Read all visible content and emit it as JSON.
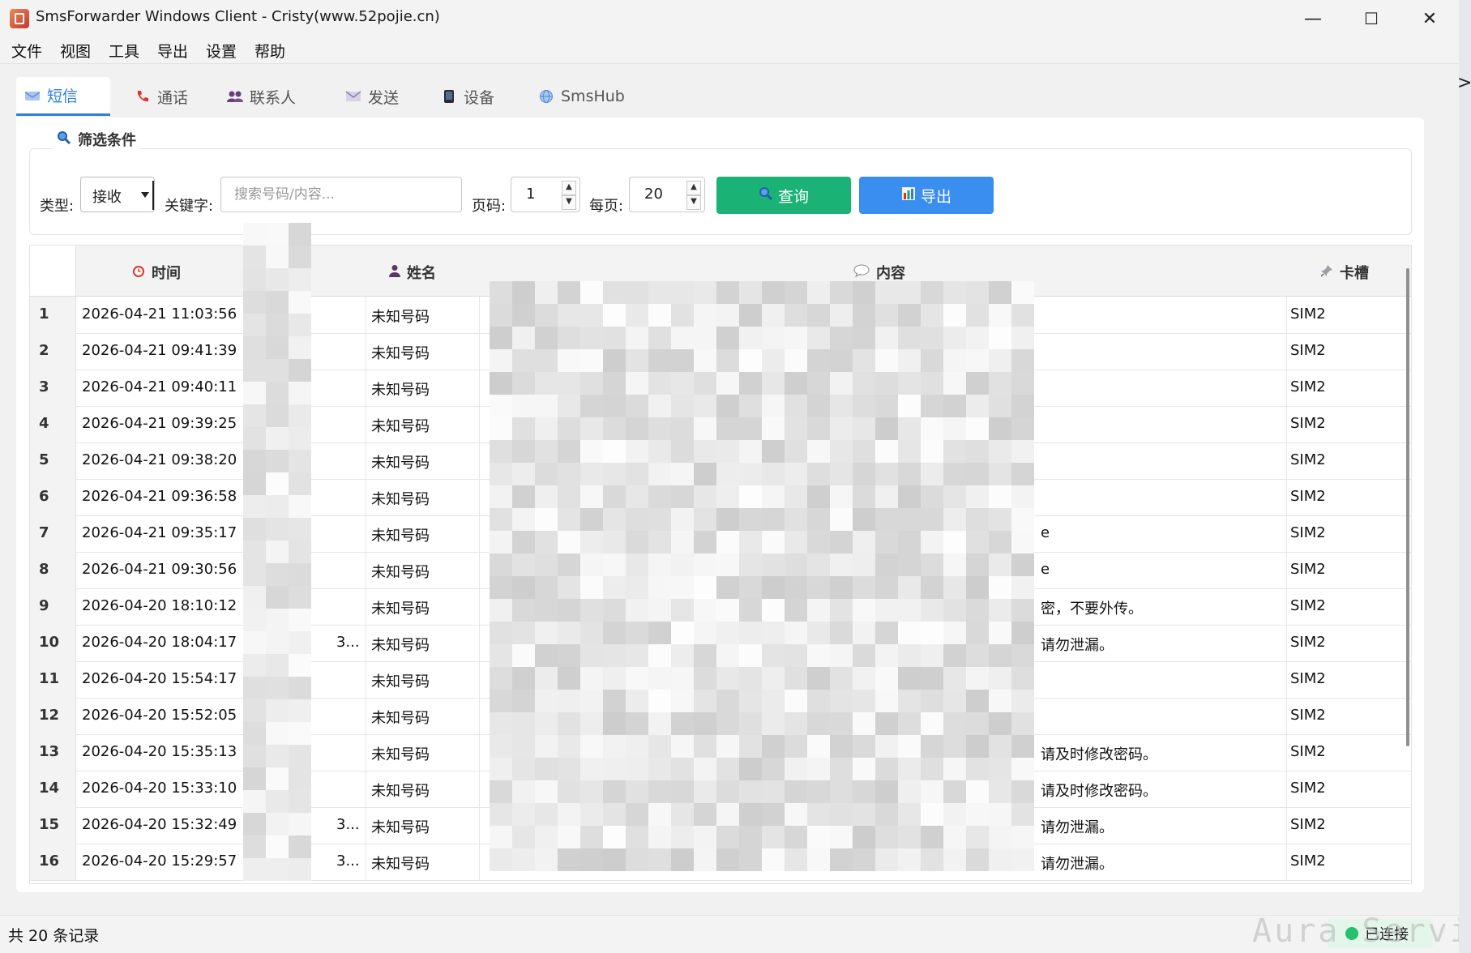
{
  "window": {
    "title": "SmsForwarder Windows Client - Cristy(www.52pojie.cn)",
    "controls": {
      "minimize": "—",
      "maximize": "☐",
      "close": "✕"
    }
  },
  "menu": [
    "文件",
    "视图",
    "工具",
    "导出",
    "设置",
    "帮助"
  ],
  "tabs": [
    {
      "label": "短信",
      "icon": "sms-icon",
      "active": true
    },
    {
      "label": "通话",
      "icon": "phone-icon",
      "active": false
    },
    {
      "label": "联系人",
      "icon": "contacts-icon",
      "active": false
    },
    {
      "label": "发送",
      "icon": "mail-icon",
      "active": false
    },
    {
      "label": "设备",
      "icon": "device-icon",
      "active": false
    },
    {
      "label": "SmsHub",
      "icon": "globe-icon",
      "active": false
    }
  ],
  "filter": {
    "title": "筛选条件",
    "type_label": "类型:",
    "type_value": "接收",
    "keyword_label": "关键字:",
    "keyword_placeholder": "搜索号码/内容...",
    "page_label": "页码:",
    "page_value": "1",
    "per_page_label": "每页:",
    "per_page_value": "20",
    "query_button": "查询",
    "export_button": "导出"
  },
  "table": {
    "columns": {
      "time": "时间",
      "name": "姓名",
      "content": "内容",
      "slot": "卡槽"
    },
    "rows": [
      {
        "idx": "1",
        "time": "2026-04-21 11:03:56",
        "num_prefix": "1",
        "num_suffix": "",
        "name": "未知号码",
        "content_head": "【",
        "content_tail": "",
        "slot": "SIM2"
      },
      {
        "idx": "2",
        "time": "2026-04-21 09:41:39",
        "num_prefix": "1",
        "num_suffix": "",
        "name": "未知号码",
        "content_head": "【",
        "content_tail": "",
        "slot": "SIM2"
      },
      {
        "idx": "3",
        "time": "2026-04-21 09:40:11",
        "num_prefix": "1",
        "num_suffix": "",
        "name": "未知号码",
        "content_head": "【",
        "content_tail": "",
        "slot": "SIM2"
      },
      {
        "idx": "4",
        "time": "2026-04-21 09:39:25",
        "num_prefix": "1",
        "num_suffix": "",
        "name": "未知号码",
        "content_head": "【",
        "content_tail": "",
        "slot": "SIM2"
      },
      {
        "idx": "5",
        "time": "2026-04-21 09:38:20",
        "num_prefix": "1",
        "num_suffix": "",
        "name": "未知号码",
        "content_head": "【",
        "content_tail": "",
        "slot": "SIM2"
      },
      {
        "idx": "6",
        "time": "2026-04-21 09:36:58",
        "num_prefix": "1",
        "num_suffix": "",
        "name": "未知号码",
        "content_head": "【",
        "content_tail": "",
        "slot": "SIM2"
      },
      {
        "idx": "7",
        "time": "2026-04-21 09:35:17",
        "num_prefix": "1",
        "num_suffix": "",
        "name": "未知号码",
        "content_head": "【",
        "content_tail": "e",
        "slot": "SIM2"
      },
      {
        "idx": "8",
        "time": "2026-04-21 09:30:56",
        "num_prefix": "1",
        "num_suffix": "",
        "name": "未知号码",
        "content_head": "【",
        "content_tail": "e",
        "slot": "SIM2"
      },
      {
        "idx": "9",
        "time": "2026-04-20 18:10:12",
        "num_prefix": "1",
        "num_suffix": "",
        "name": "未知号码",
        "content_head": "【",
        "content_tail": "密，不要外传。",
        "slot": "SIM2"
      },
      {
        "idx": "10",
        "time": "2026-04-20 18:04:17",
        "num_prefix": "1",
        "num_suffix": "3...",
        "name": "未知号码",
        "content_head": "【",
        "content_tail": "请勿泄漏。",
        "slot": "SIM2"
      },
      {
        "idx": "11",
        "time": "2026-04-20 15:54:17",
        "num_prefix": "1",
        "num_suffix": "",
        "name": "未知号码",
        "content_head": "【",
        "content_tail": "",
        "slot": "SIM2"
      },
      {
        "idx": "12",
        "time": "2026-04-20 15:52:05",
        "num_prefix": "1",
        "num_suffix": "",
        "name": "未知号码",
        "content_head": "【",
        "content_tail": "",
        "slot": "SIM2"
      },
      {
        "idx": "13",
        "time": "2026-04-20 15:35:13",
        "num_prefix": "1",
        "num_suffix": "",
        "name": "未知号码",
        "content_head": "【",
        "content_tail": "请及时修改密码。",
        "slot": "SIM2"
      },
      {
        "idx": "14",
        "time": "2026-04-20 15:33:10",
        "num_prefix": "1",
        "num_suffix": "",
        "name": "未知号码",
        "content_head": "【",
        "content_tail": "请及时修改密码。",
        "slot": "SIM2"
      },
      {
        "idx": "15",
        "time": "2026-04-20 15:32:49",
        "num_prefix": "1",
        "num_suffix": "3...",
        "name": "未知号码",
        "content_head": "【",
        "content_tail": "请勿泄漏。",
        "slot": "SIM2"
      },
      {
        "idx": "16",
        "time": "2026-04-20 15:29:57",
        "num_prefix": "1",
        "num_suffix": "3...",
        "name": "未知号码",
        "content_head": "【",
        "content_tail": "请勿泄漏。",
        "slot": "SIM2"
      }
    ]
  },
  "status": {
    "record_count": "共 20 条记录",
    "connection": "已连接"
  },
  "watermark": "Aura Service",
  "colors": {
    "accent": "#2f7de1",
    "query_button": "#1bb275",
    "export_button": "#3a8ef0",
    "connected": "#25c16f"
  }
}
